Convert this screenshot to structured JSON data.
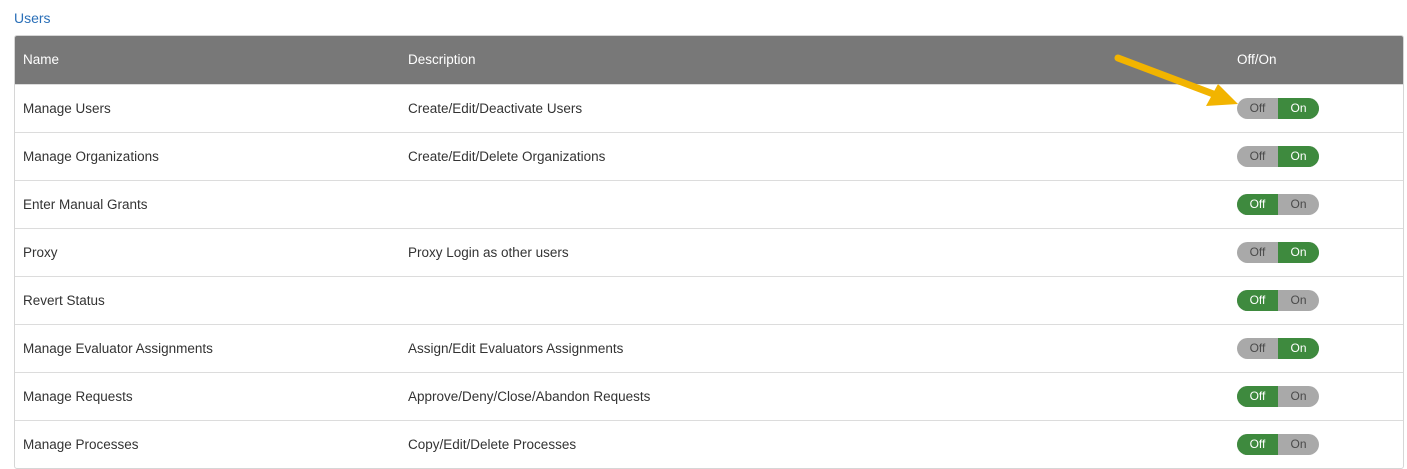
{
  "section": {
    "title": "Users"
  },
  "table": {
    "headers": {
      "name": "Name",
      "description": "Description",
      "toggle": "Off/On"
    },
    "toggle_labels": {
      "off": "Off",
      "on": "On"
    },
    "rows": [
      {
        "name": "Manage Users",
        "description": "Create/Edit/Deactivate Users",
        "state": "on"
      },
      {
        "name": "Manage Organizations",
        "description": "Create/Edit/Delete Organizations",
        "state": "on"
      },
      {
        "name": "Enter Manual Grants",
        "description": "",
        "state": "off"
      },
      {
        "name": "Proxy",
        "description": "Proxy Login as other users",
        "state": "on"
      },
      {
        "name": "Revert Status",
        "description": "",
        "state": "off"
      },
      {
        "name": "Manage Evaluator Assignments",
        "description": "Assign/Edit Evaluators Assignments",
        "state": "on"
      },
      {
        "name": "Manage Requests",
        "description": "Approve/Deny/Close/Abandon Requests",
        "state": "off"
      },
      {
        "name": "Manage Processes",
        "description": "Copy/Edit/Delete Processes",
        "state": "off"
      }
    ]
  },
  "colors": {
    "header_bg": "#787878",
    "toggle_active": "#3e8a3e",
    "toggle_inactive": "#a9a9a9",
    "link": "#2a6fb8",
    "arrow": "#f2b400"
  },
  "annotation": {
    "icon": "arrow-icon",
    "target_row": 0
  }
}
